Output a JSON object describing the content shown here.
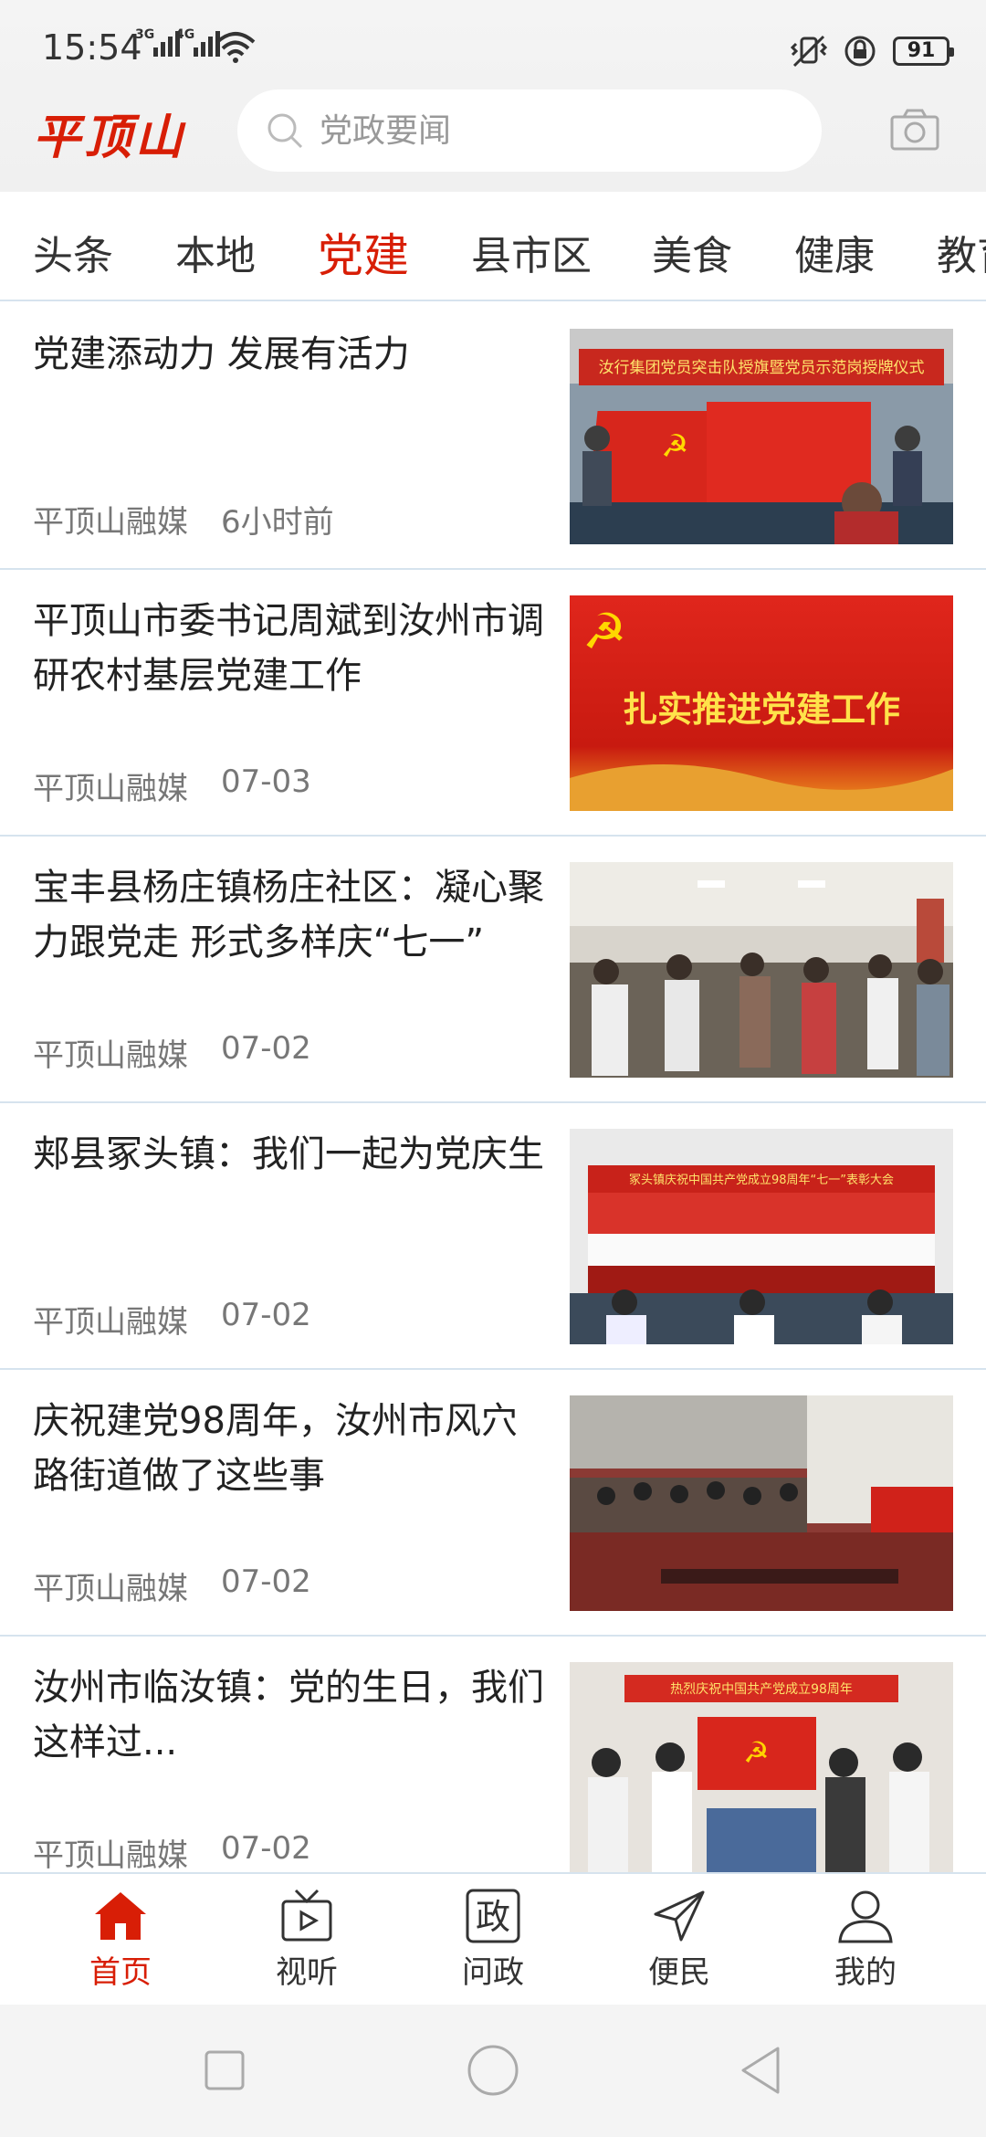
{
  "status_bar": {
    "time": "15:54",
    "network1": "3G",
    "network2": "4G",
    "battery": "91"
  },
  "header": {
    "logo": "平顶山",
    "search_placeholder": "党政要闻"
  },
  "tabs": [
    {
      "label": "头条"
    },
    {
      "label": "本地"
    },
    {
      "label": "党建",
      "active": true
    },
    {
      "label": "县市区"
    },
    {
      "label": "美食"
    },
    {
      "label": "健康"
    },
    {
      "label": "教育"
    }
  ],
  "news": [
    {
      "title": "党建添动力 发展有活力",
      "source": "平顶山融媒",
      "time": "6小时前",
      "image_text": "汝行集团党员突击队授旗暨党员示范岗授牌仪式"
    },
    {
      "title": "平顶山市委书记周斌到汝州市调研农村基层党建工作",
      "source": "平顶山融媒",
      "time": "07-03",
      "image_text": "扎实推进党建工作"
    },
    {
      "title": "宝丰县杨庄镇杨庄社区：凝心聚力跟党走 形式多样庆“七一”",
      "source": "平顶山融媒",
      "time": "07-02",
      "image_text": ""
    },
    {
      "title": "郏县冢头镇：我们一起为党庆生",
      "source": "平顶山融媒",
      "time": "07-02",
      "image_text": "冢头镇庆祝中国共产党成立98周年“七一”表彰大会"
    },
    {
      "title": "庆祝建党98周年，汝州市风穴路街道做了这些事",
      "source": "平顶山融媒",
      "time": "07-02",
      "image_text": ""
    },
    {
      "title": "汝州市临汝镇：党的生日，我们这样过...",
      "source": "平顶山融媒",
      "time": "07-02",
      "image_text": "热烈庆祝中国共产党成立98周年"
    }
  ],
  "bottom_nav": [
    {
      "label": "首页",
      "icon": "home-icon",
      "active": true
    },
    {
      "label": "视听",
      "icon": "tv-icon"
    },
    {
      "label": "问政",
      "icon": "zheng-icon",
      "glyph": "政"
    },
    {
      "label": "便民",
      "icon": "send-icon"
    },
    {
      "label": "我的",
      "icon": "user-icon"
    }
  ],
  "colors": {
    "accent": "#d81e06",
    "divider": "#d6e3ee",
    "header_bg": "#f2f2f2"
  }
}
